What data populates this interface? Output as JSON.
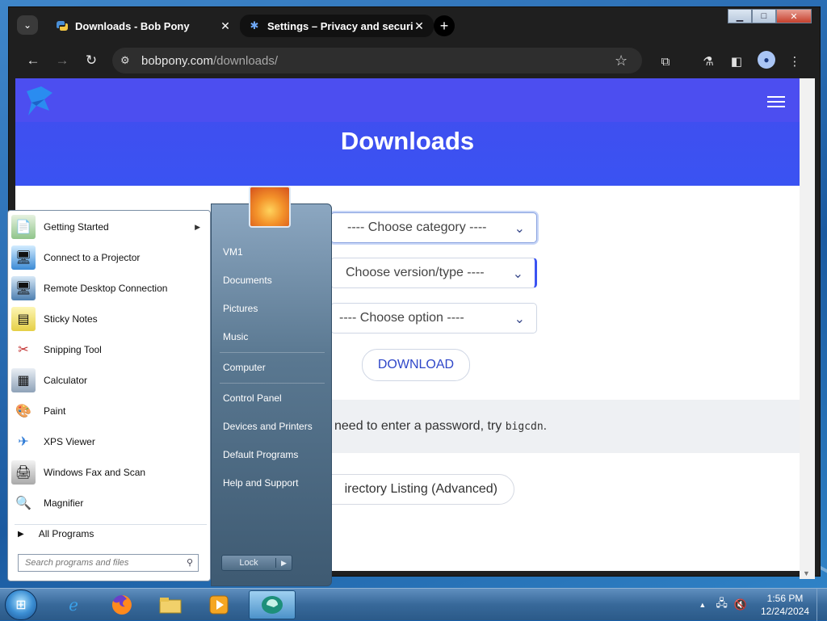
{
  "browser": {
    "tabs": [
      {
        "title": "Downloads - Bob Pony",
        "icon": "snake-icon",
        "active": true
      },
      {
        "title": "Settings – Privacy and security",
        "icon": "gear-icon",
        "active": false
      }
    ],
    "url_domain": "bobpony.com",
    "url_path": "/downloads/",
    "window_controls": {
      "minimize": "▁",
      "maximize": "□",
      "close": "✕"
    }
  },
  "page": {
    "title": "Downloads",
    "selects": {
      "category": "---- Choose category ----",
      "version": "Choose version/type ----",
      "option": "---- Choose option ----"
    },
    "download_button": "DOWNLOAD",
    "notice_prefix": "need to enter a password, try",
    "notice_code": "bigcdn",
    "notice_suffix": ".",
    "directory_button": "irectory Listing (Advanced)"
  },
  "start_menu": {
    "programs": [
      {
        "label": "Getting Started",
        "icon": "getting-started-icon",
        "has_submenu": true
      },
      {
        "label": "Connect to a Projector",
        "icon": "projector-icon"
      },
      {
        "label": "Remote Desktop Connection",
        "icon": "remote-desktop-icon"
      },
      {
        "label": "Sticky Notes",
        "icon": "sticky-notes-icon"
      },
      {
        "label": "Snipping Tool",
        "icon": "snipping-tool-icon"
      },
      {
        "label": "Calculator",
        "icon": "calculator-icon"
      },
      {
        "label": "Paint",
        "icon": "paint-icon"
      },
      {
        "label": "XPS Viewer",
        "icon": "xps-viewer-icon"
      },
      {
        "label": "Windows Fax and Scan",
        "icon": "fax-scan-icon"
      },
      {
        "label": "Magnifier",
        "icon": "magnifier-icon"
      }
    ],
    "all_programs": "All Programs",
    "search_placeholder": "Search programs and files",
    "right_items": [
      "VM1",
      "Documents",
      "Pictures",
      "Music",
      "Computer",
      "Control Panel",
      "Devices and Printers",
      "Default Programs",
      "Help and Support"
    ],
    "lock_label": "Lock"
  },
  "taskbar": {
    "apps": [
      "ie-icon",
      "firefox-icon",
      "explorer-icon",
      "media-player-icon",
      "app-icon"
    ],
    "time": "1:56 PM",
    "date": "12/24/2024"
  }
}
